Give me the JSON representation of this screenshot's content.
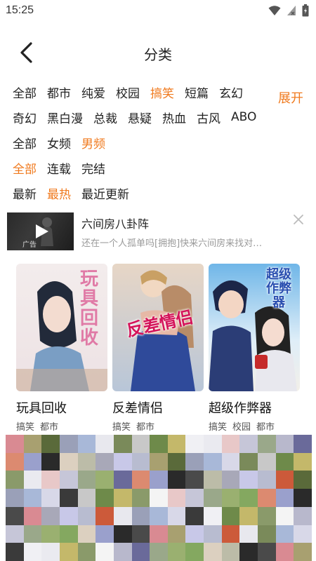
{
  "status_bar": {
    "time": "15:25"
  },
  "header": {
    "title": "分类"
  },
  "filters": {
    "expand_label": "展开",
    "genre_row1": [
      {
        "label": "全部",
        "active": false
      },
      {
        "label": "都市",
        "active": false
      },
      {
        "label": "纯爱",
        "active": false
      },
      {
        "label": "校园",
        "active": false
      },
      {
        "label": "搞笑",
        "active": true
      },
      {
        "label": "短篇",
        "active": false
      },
      {
        "label": "玄幻",
        "active": false
      }
    ],
    "genre_row2": [
      {
        "label": "奇幻",
        "active": false
      },
      {
        "label": "黑白漫",
        "active": false
      },
      {
        "label": "总裁",
        "active": false
      },
      {
        "label": "悬疑",
        "active": false
      },
      {
        "label": "热血",
        "active": false
      },
      {
        "label": "古风",
        "active": false
      },
      {
        "label": "ABO",
        "active": false
      }
    ],
    "audience_row": [
      {
        "label": "全部",
        "active": false
      },
      {
        "label": "女频",
        "active": false
      },
      {
        "label": "男频",
        "active": true
      }
    ],
    "status_row": [
      {
        "label": "全部",
        "active": true
      },
      {
        "label": "连载",
        "active": false
      },
      {
        "label": "完结",
        "active": false
      }
    ],
    "sort_row": [
      {
        "label": "最新",
        "active": false
      },
      {
        "label": "最热",
        "active": true
      },
      {
        "label": "最近更新",
        "active": false
      }
    ]
  },
  "ad": {
    "title": "六间房八卦阵",
    "description": "还在一个人孤单吗[拥抱]快来六间房来找对…",
    "badge": "广告"
  },
  "comics": [
    {
      "title": "玩具回收",
      "cover_text": "玩具回收",
      "tags": [
        "搞笑",
        "都市"
      ]
    },
    {
      "title": "反差情侣",
      "cover_text": "反差情侣",
      "tags": [
        "搞笑",
        "都市"
      ]
    },
    {
      "title": "超级作弊器",
      "cover_text": "超级作弊器",
      "tags": [
        "搞笑",
        "校园",
        "都市"
      ]
    }
  ],
  "colors": {
    "accent": "#f07a1e",
    "text": "#222222",
    "muted": "#9a9a9a"
  }
}
